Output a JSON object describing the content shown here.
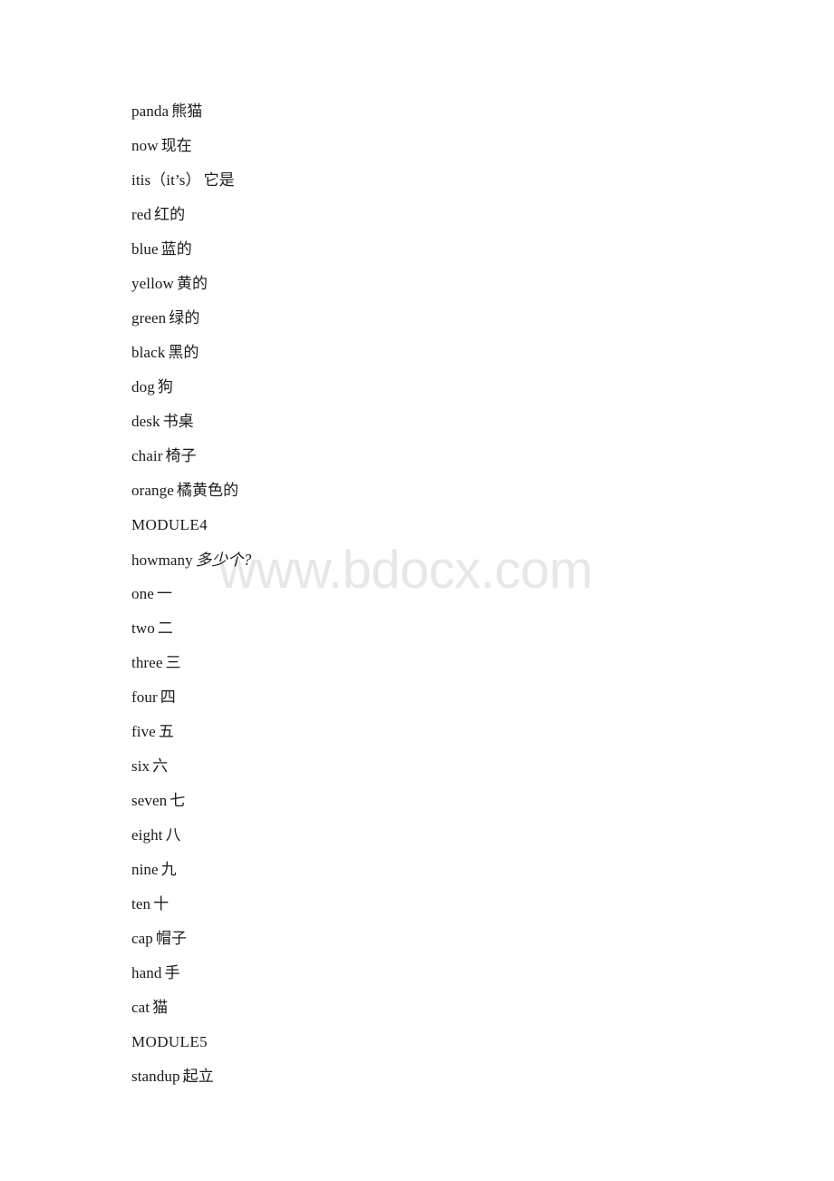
{
  "document": {
    "background_color": "#ffffff",
    "text_color": "#1b1b1b"
  },
  "watermark": {
    "text": "www.bdocx.com",
    "color": "#e7e7e7"
  },
  "lines": [
    {
      "en": "panda",
      "cn": "熊猫",
      "type": "entry"
    },
    {
      "en": "now",
      "cn": "现在",
      "type": "entry"
    },
    {
      "en": "itis（it’s）",
      "cn": "它是",
      "type": "entry"
    },
    {
      "en": "red",
      "cn": "红的",
      "type": "entry"
    },
    {
      "en": "blue",
      "cn": "蓝的",
      "type": "entry"
    },
    {
      "en": "yellow",
      "cn": "黄的",
      "type": "entry"
    },
    {
      "en": "green",
      "cn": "绿的",
      "type": "entry"
    },
    {
      "en": "black",
      "cn": "黑的",
      "type": "entry"
    },
    {
      "en": "dog",
      "cn": "狗",
      "type": "entry"
    },
    {
      "en": "desk",
      "cn": "书桌",
      "type": "entry"
    },
    {
      "en": "chair",
      "cn": "椅子",
      "type": "entry"
    },
    {
      "en": "orange",
      "cn": "橘黄色的",
      "type": "entry"
    },
    {
      "en": "MODULE4",
      "cn": "",
      "type": "module"
    },
    {
      "en": "howmany",
      "cn": "多少个?",
      "type": "entry",
      "style": "script"
    },
    {
      "en": "one",
      "cn": "一",
      "type": "entry"
    },
    {
      "en": "two",
      "cn": "二",
      "type": "entry"
    },
    {
      "en": "three",
      "cn": "三",
      "type": "entry"
    },
    {
      "en": "four",
      "cn": "四",
      "type": "entry"
    },
    {
      "en": "five",
      "cn": "五",
      "type": "entry"
    },
    {
      "en": "six",
      "cn": "六",
      "type": "entry"
    },
    {
      "en": "seven",
      "cn": "七",
      "type": "entry"
    },
    {
      "en": "eight",
      "cn": "八",
      "type": "entry"
    },
    {
      "en": "nine",
      "cn": "九",
      "type": "entry"
    },
    {
      "en": "ten",
      "cn": "十",
      "type": "entry"
    },
    {
      "en": "cap",
      "cn": "帽子",
      "type": "entry"
    },
    {
      "en": "hand",
      "cn": "手",
      "type": "entry"
    },
    {
      "en": "cat",
      "cn": "猫",
      "type": "entry"
    },
    {
      "en": "MODULE5",
      "cn": "",
      "type": "module"
    },
    {
      "en": "standup",
      "cn": "起立",
      "type": "entry"
    }
  ]
}
